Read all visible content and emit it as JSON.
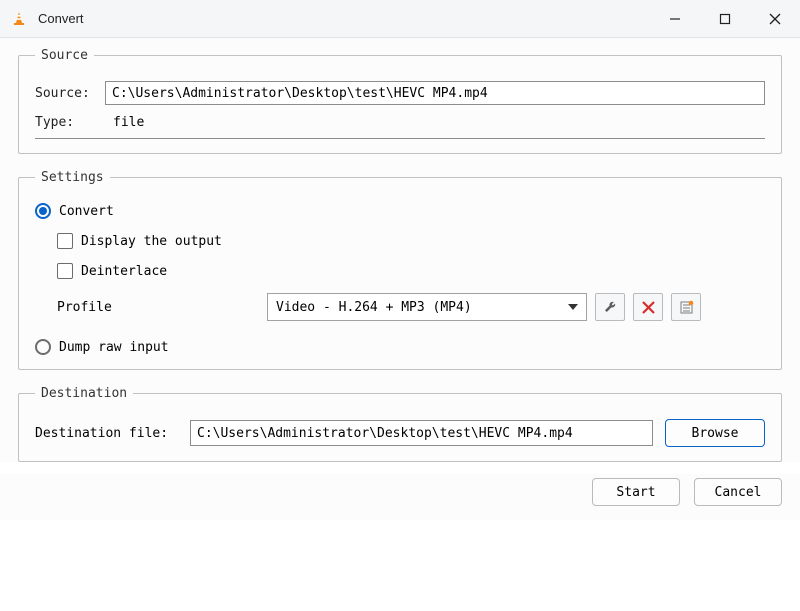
{
  "window": {
    "title": "Convert"
  },
  "source_group": {
    "legend": "Source",
    "source_label": "Source:",
    "source_value": "C:\\Users\\Administrator\\Desktop\\test\\HEVC MP4.mp4",
    "type_label": "Type:",
    "type_value": "file"
  },
  "settings_group": {
    "legend": "Settings",
    "convert_label": "Convert",
    "display_output_label": "Display the output",
    "deinterlace_label": "Deinterlace",
    "profile_label": "Profile",
    "profile_value": "Video - H.264 + MP3 (MP4)",
    "dump_label": "Dump raw input"
  },
  "destination_group": {
    "legend": "Destination",
    "dest_label": "Destination file:",
    "dest_value": "C:\\Users\\Administrator\\Desktop\\test\\HEVC MP4.mp4",
    "browse_label": "Browse"
  },
  "footer": {
    "start_label": "Start",
    "cancel_label": "Cancel"
  }
}
